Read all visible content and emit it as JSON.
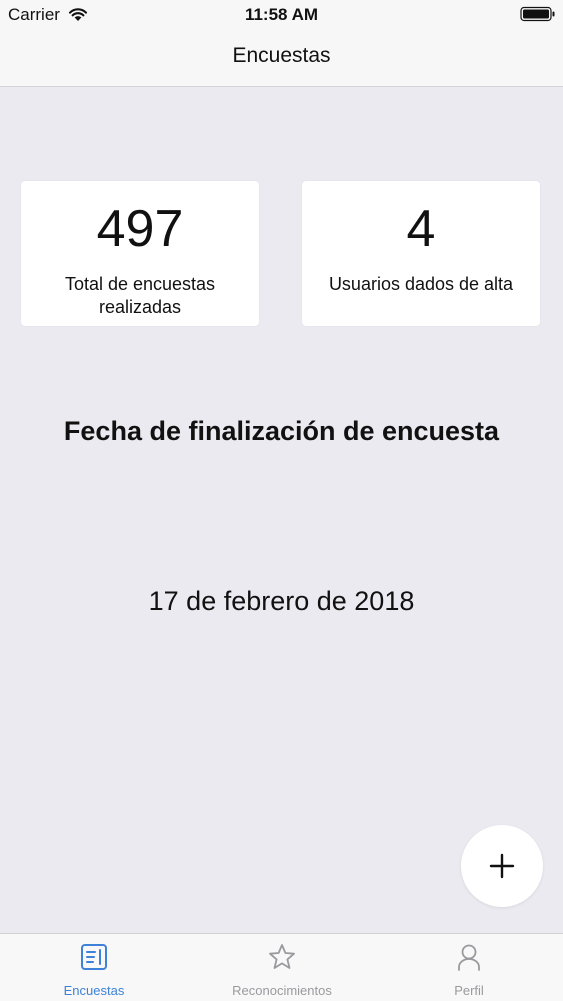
{
  "status_bar": {
    "carrier": "Carrier",
    "time": "11:58 AM",
    "wifi_icon": "wifi-icon",
    "battery_icon": "battery-icon"
  },
  "nav": {
    "title": "Encuestas"
  },
  "stats": [
    {
      "value": "497",
      "label": "Total de encuestas realizadas"
    },
    {
      "value": "4",
      "label": "Usuarios dados de alta"
    }
  ],
  "section": {
    "heading": "Fecha de finalización de encuesta",
    "date": "17 de febrero de 2018"
  },
  "fab": {
    "icon": "plus-icon"
  },
  "tabs": [
    {
      "label": "Encuestas",
      "icon": "survey-list-icon",
      "active": true
    },
    {
      "label": "Reconocimientos",
      "icon": "star-icon",
      "active": false
    },
    {
      "label": "Perfil",
      "icon": "person-icon",
      "active": false
    }
  ],
  "colors": {
    "background": "#ebeaf0",
    "bar_background": "#f7f7f7",
    "card_background": "#ffffff",
    "accent": "#3d82d8",
    "inactive": "#9a9a9e"
  }
}
